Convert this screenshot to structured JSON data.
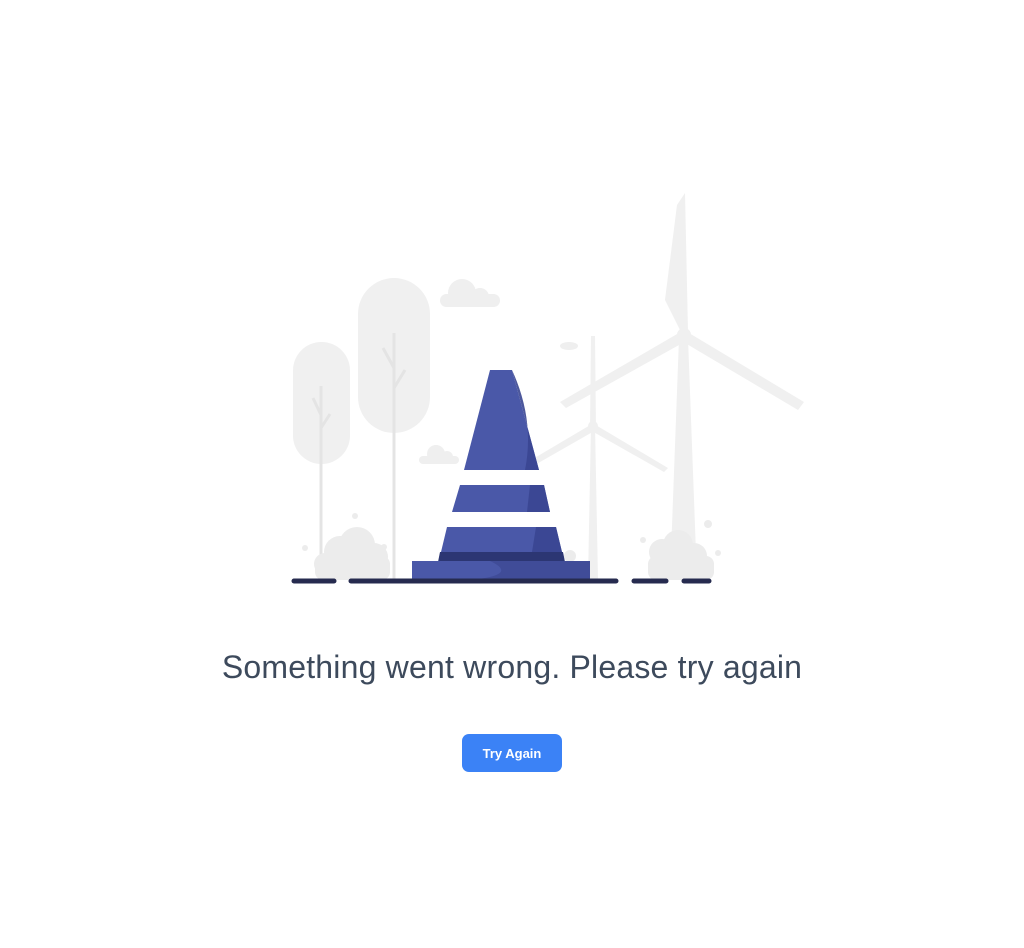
{
  "error": {
    "message": "Something went wrong. Please try again",
    "retry_label": "Try Again"
  },
  "illustration": {
    "icon": "traffic-cone-icon",
    "background": [
      "tree-icon",
      "cloud-icon",
      "wind-turbine-icon",
      "bush-icon"
    ]
  },
  "colors": {
    "accent": "#3b82f6",
    "cone": "#4a58a8",
    "cone_dark": "#2c3673",
    "ground": "#262b4f",
    "background_art": "#ececec",
    "text": "#3d4a5c"
  }
}
